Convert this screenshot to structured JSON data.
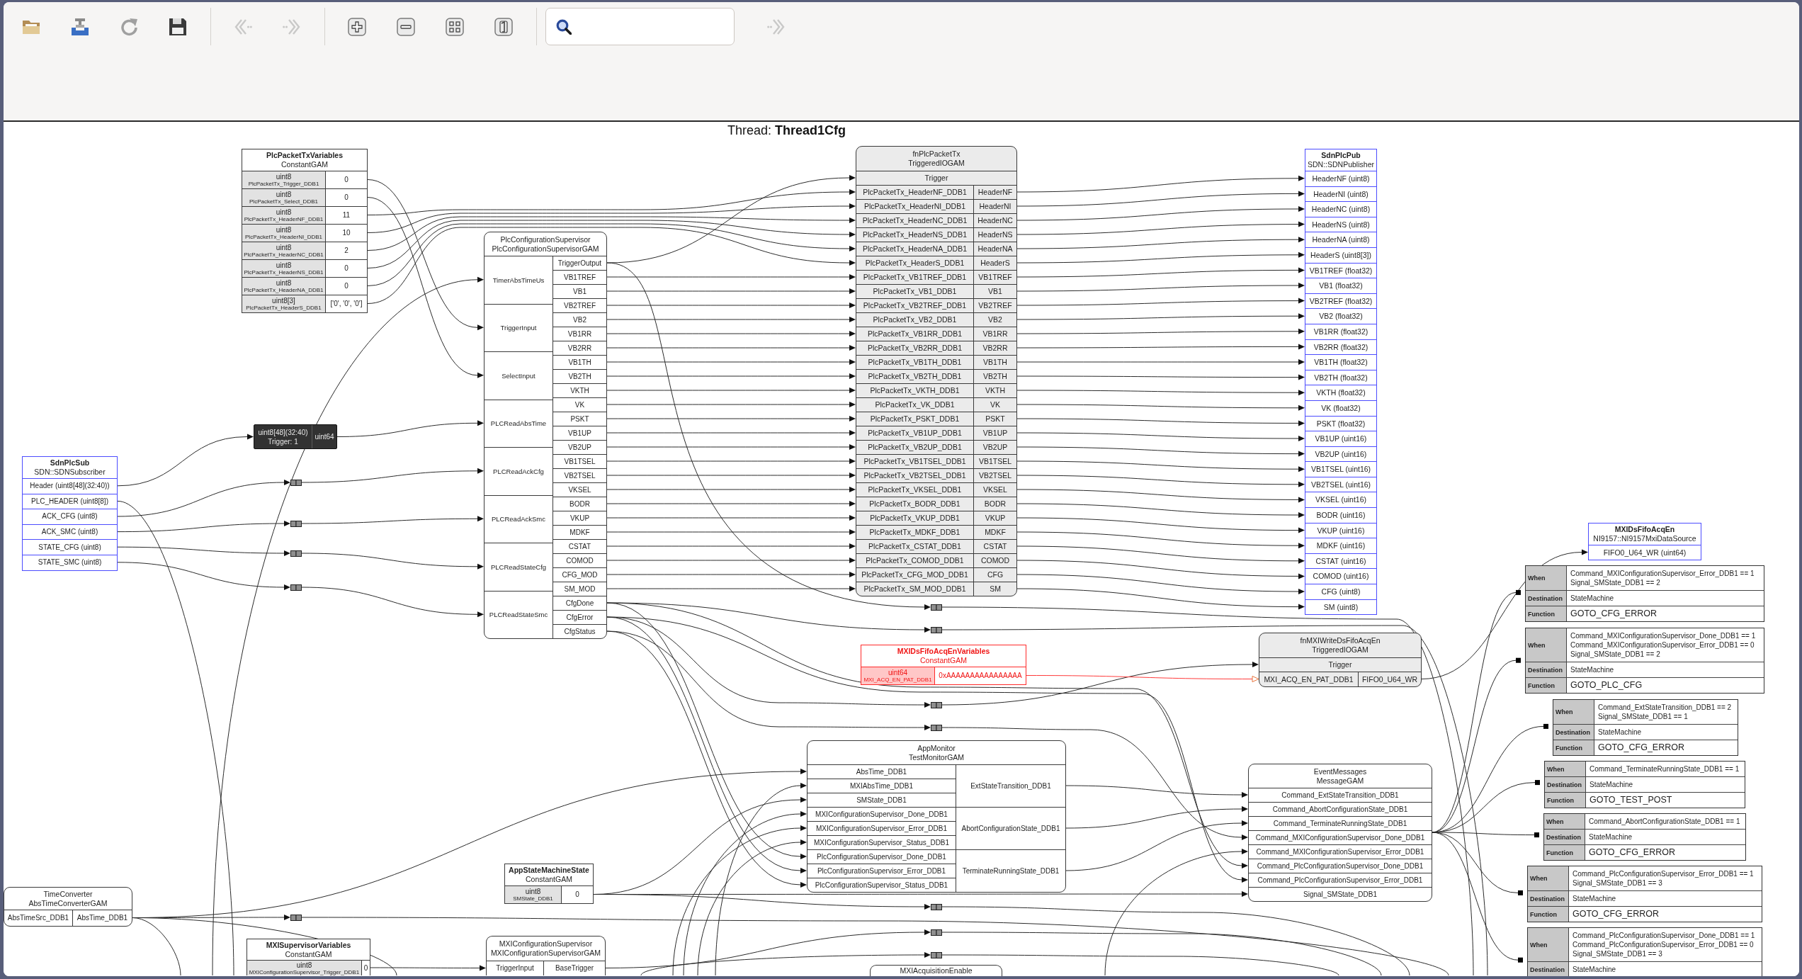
{
  "toolbar": {
    "groups": [
      [
        {
          "kind": "open",
          "disabled": false
        },
        {
          "kind": "import",
          "disabled": false
        },
        {
          "kind": "reload",
          "disabled": false
        },
        {
          "kind": "save",
          "disabled": false
        }
      ],
      [
        {
          "kind": "back",
          "disabled": true
        },
        {
          "kind": "forward",
          "disabled": true
        }
      ],
      [
        {
          "kind": "zoom_in",
          "disabled": false
        },
        {
          "kind": "zoom_out",
          "disabled": false
        },
        {
          "kind": "zoom_fit",
          "disabled": false
        },
        {
          "kind": "zoom_reset",
          "disabled": false
        }
      ]
    ],
    "find_next": {
      "disabled": true
    }
  },
  "thread_title": "Thread: **Thread1Cfg**",
  "nodes": [
    {
      "kind": "constant",
      "name": "PlcPacketTxVariables",
      "class": "ConstantGAM",
      "highlighted": false,
      "rows": [
        {
          "type": "uint8",
          "signal": "PlcPacketTx_Trigger_DDB1",
          "value": "0"
        },
        {
          "type": "uint8",
          "signal": "PlcPacketTx_Select_DDB1",
          "value": "0"
        },
        {
          "type": "uint8",
          "signal": "PlcPacketTx_HeaderNF_DDB1",
          "value": "11"
        },
        {
          "type": "uint8",
          "signal": "PlcPacketTx_HeaderNI_DDB1",
          "value": "10"
        },
        {
          "type": "uint8",
          "signal": "PlcPacketTx_HeaderNC_DDB1",
          "value": "2"
        },
        {
          "type": "uint8",
          "signal": "PlcPacketTx_HeaderNS_DDB1",
          "value": "0"
        },
        {
          "type": "uint8",
          "signal": "PlcPacketTx_HeaderNA_DDB1",
          "value": "0"
        },
        {
          "type": "uint8[3]",
          "signal": "PlcPacketTx_HeaderS_DDB1",
          "value": "['0', '0', '0']"
        }
      ]
    },
    {
      "kind": "buffer",
      "type": "uint8[48](32:40)",
      "trigger": "Trigger: 1",
      "output": "uint64"
    },
    {
      "kind": "datasource",
      "name": "SdnPlcSub",
      "class": "SDN::SDNSubscriber",
      "signals": [
        "Header (uint8[48](32:40))",
        "PLC_HEADER (uint8[8])",
        "ACK_CFG (uint8)",
        "ACK_SMC (uint8)",
        "STATE_CFG (uint8)",
        "STATE_SMC (uint8)"
      ]
    },
    {
      "kind": "gam",
      "name": "PlcConfigurationSupervisor",
      "class": "PlcConfigurationSupervisorGAM",
      "inputs": [
        "TimerAbsTimeUs",
        "TriggerInput",
        "SelectInput",
        "PLCReadAbsTime",
        "PLCReadAckCfg",
        "PLCReadAckSmc",
        "PLCReadStateCfg",
        "PLCReadStateSmc"
      ],
      "outputs": [
        "TriggerOutput",
        "VB1TREF",
        "VB1",
        "VB2TREF",
        "VB2",
        "VB1RR",
        "VB2RR",
        "VB1TH",
        "VB2TH",
        "VKTH",
        "VK",
        "PSKT",
        "VB1UP",
        "VB2UP",
        "VB1TSEL",
        "VB2TSEL",
        "VKSEL",
        "BODR",
        "VKUP",
        "MDKF",
        "CSTAT",
        "COMOD",
        "CFG_MOD",
        "SM_MOD",
        "CfgDone",
        "CfgError",
        "CfgStatus"
      ]
    },
    {
      "kind": "iogam",
      "name": "fnPlcPacketTx",
      "class": "TriggeredIOGAM",
      "trigger": "Trigger",
      "pairs": [
        {
          "input": "PlcPacketTx_HeaderNF_DDB1",
          "output": "HeaderNF"
        },
        {
          "input": "PlcPacketTx_HeaderNI_DDB1",
          "output": "HeaderNI"
        },
        {
          "input": "PlcPacketTx_HeaderNC_DDB1",
          "output": "HeaderNC"
        },
        {
          "input": "PlcPacketTx_HeaderNS_DDB1",
          "output": "HeaderNS"
        },
        {
          "input": "PlcPacketTx_HeaderNA_DDB1",
          "output": "HeaderNA"
        },
        {
          "input": "PlcPacketTx_HeaderS_DDB1",
          "output": "HeaderS"
        },
        {
          "input": "PlcPacketTx_VB1TREF_DDB1",
          "output": "VB1TREF"
        },
        {
          "input": "PlcPacketTx_VB1_DDB1",
          "output": "VB1"
        },
        {
          "input": "PlcPacketTx_VB2TREF_DDB1",
          "output": "VB2TREF"
        },
        {
          "input": "PlcPacketTx_VB2_DDB1",
          "output": "VB2"
        },
        {
          "input": "PlcPacketTx_VB1RR_DDB1",
          "output": "VB1RR"
        },
        {
          "input": "PlcPacketTx_VB2RR_DDB1",
          "output": "VB2RR"
        },
        {
          "input": "PlcPacketTx_VB1TH_DDB1",
          "output": "VB1TH"
        },
        {
          "input": "PlcPacketTx_VB2TH_DDB1",
          "output": "VB2TH"
        },
        {
          "input": "PlcPacketTx_VKTH_DDB1",
          "output": "VKTH"
        },
        {
          "input": "PlcPacketTx_VK_DDB1",
          "output": "VK"
        },
        {
          "input": "PlcPacketTx_PSKT_DDB1",
          "output": "PSKT"
        },
        {
          "input": "PlcPacketTx_VB1UP_DDB1",
          "output": "VB1UP"
        },
        {
          "input": "PlcPacketTx_VB2UP_DDB1",
          "output": "VB2UP"
        },
        {
          "input": "PlcPacketTx_VB1TSEL_DDB1",
          "output": "VB1TSEL"
        },
        {
          "input": "PlcPacketTx_VB2TSEL_DDB1",
          "output": "VB2TSEL"
        },
        {
          "input": "PlcPacketTx_VKSEL_DDB1",
          "output": "VKSEL"
        },
        {
          "input": "PlcPacketTx_BODR_DDB1",
          "output": "BODR"
        },
        {
          "input": "PlcPacketTx_VKUP_DDB1",
          "output": "VKUP"
        },
        {
          "input": "PlcPacketTx_MDKF_DDB1",
          "output": "MDKF"
        },
        {
          "input": "PlcPacketTx_CSTAT_DDB1",
          "output": "CSTAT"
        },
        {
          "input": "PlcPacketTx_COMOD_DDB1",
          "output": "COMOD"
        },
        {
          "input": "PlcPacketTx_CFG_MOD_DDB1",
          "output": "CFG"
        },
        {
          "input": "PlcPacketTx_SM_MOD_DDB1",
          "output": "SM"
        }
      ]
    },
    {
      "kind": "datasource",
      "name": "SdnPlcPub",
      "class": "SDN::SDNPublisher",
      "signals": [
        "HeaderNF (uint8)",
        "HeaderNI (uint8)",
        "HeaderNC (uint8)",
        "HeaderNS (uint8)",
        "HeaderNA (uint8)",
        "HeaderS (uint8[3])",
        "VB1TREF (float32)",
        "VB1 (float32)",
        "VB2TREF (float32)",
        "VB2 (float32)",
        "VB1RR (float32)",
        "VB2RR (float32)",
        "VB1TH (float32)",
        "VB2TH (float32)",
        "VKTH (float32)",
        "VK (float32)",
        "PSKT (float32)",
        "VB1UP (uint16)",
        "VB2UP (uint16)",
        "VB1TSEL (uint16)",
        "VB2TSEL (uint16)",
        "VKSEL (uint16)",
        "BODR (uint16)",
        "VKUP (uint16)",
        "MDKF (uint16)",
        "CSTAT (uint16)",
        "COMOD (uint16)",
        "CFG (uint8)",
        "SM (uint8)"
      ]
    },
    {
      "kind": "datasource",
      "name": "MXIDsFifoAcqEn",
      "class": "NI9157::NI9157MxiDataSource",
      "signals": [
        "FIFO0_U64_WR (uint64)"
      ]
    },
    {
      "kind": "constant",
      "name": "MXIDsFifoAcqEnVariables",
      "class": "ConstantGAM",
      "highlighted": true,
      "rows": [
        {
          "type": "uint64",
          "signal": "MXI_ACQ_EN_PAT_DDB1",
          "value": "0xAAAAAAAAAAAAAAAA"
        }
      ]
    },
    {
      "kind": "iogam",
      "name": "fnMXIWriteDsFifoAcqEn",
      "class": "TriggeredIOGAM",
      "trigger": "Trigger",
      "pairs": [
        {
          "input": "MXI_ACQ_EN_PAT_DDB1",
          "output": "FIFO0_U64_WR"
        }
      ]
    },
    {
      "kind": "gam",
      "name": "TimeConverter",
      "class": "AbsTimeConverterGAM",
      "inputs": [
        "AbsTimeSrc_DDB1"
      ],
      "outputs": [
        "AbsTime_DDB1"
      ]
    },
    {
      "kind": "constant",
      "name": "AppStateMachineState",
      "class": "ConstantGAM",
      "highlighted": false,
      "rows": [
        {
          "type": "uint8",
          "signal": "SMState_DDB1",
          "value": "0"
        }
      ]
    },
    {
      "kind": "gam",
      "name": "AppMonitor",
      "class": "TestMonitorGAM",
      "inputs": [
        "AbsTime_DDB1",
        "MXIAbsTime_DDB1",
        "SMState_DDB1",
        "MXIConfigurationSupervisor_Done_DDB1",
        "MXIConfigurationSupervisor_Error_DDB1",
        "MXIConfigurationSupervisor_Status_DDB1",
        "PlcConfigurationSupervisor_Done_DDB1",
        "PlcConfigurationSupervisor_Error_DDB1",
        "PlcConfigurationSupervisor_Status_DDB1"
      ],
      "outputs": [
        "ExtStateTransition_DDB1",
        "AbortConfigurationState_DDB1",
        "TerminateRunningState_DDB1"
      ]
    },
    {
      "kind": "gam",
      "name": "EventMessages",
      "class": "MessageGAM",
      "inputs": [
        "Command_ExtStateTransition_DDB1",
        "Command_AbortConfigurationState_DDB1",
        "Command_TerminateRunningState_DDB1",
        "Command_MXIConfigurationSupervisor_Done_DDB1",
        "Command_MXIConfigurationSupervisor_Error_DDB1",
        "Command_PlcConfigurationSupervisor_Done_DDB1",
        "Command_PlcConfigurationSupervisor_Error_DDB1",
        "Signal_SMState_DDB1"
      ]
    },
    {
      "kind": "constant",
      "name": "MXISupervisorVariables",
      "class": "ConstantGAM",
      "highlighted": false,
      "rows": [
        {
          "type": "uint8",
          "signal": "MXIConfigurationSupervisor_Trigger_DDB1",
          "value": "0"
        }
      ]
    },
    {
      "kind": "gam",
      "name": "MXIConfigurationSupervisor",
      "class": "MXIConfigurationSupervisorGAM",
      "inputs": [
        "TriggerInput"
      ],
      "outputs": [
        "BaseTrigger"
      ]
    },
    {
      "kind": "gam",
      "name": "MXIAcquisitionEnable"
    }
  ],
  "messages": [
    {
      "rows": [
        {
          "kind": "when",
          "label": "When",
          "lines": [
            "Command_MXIConfigurationSupervisor_Error_DDB1 == 1",
            "Signal_SMState_DDB1 == 2"
          ]
        },
        {
          "kind": "destination",
          "label": "Destination",
          "lines": [
            "StateMachine"
          ]
        },
        {
          "kind": "function",
          "label": "Function",
          "lines": [
            "GOTO_CFG_ERROR"
          ]
        }
      ]
    },
    {
      "rows": [
        {
          "kind": "when",
          "label": "When",
          "lines": [
            "Command_MXIConfigurationSupervisor_Done_DDB1 == 1",
            "Command_MXIConfigurationSupervisor_Error_DDB1 == 0",
            "Signal_SMState_DDB1 == 2"
          ]
        },
        {
          "kind": "destination",
          "label": "Destination",
          "lines": [
            "StateMachine"
          ]
        },
        {
          "kind": "function",
          "label": "Function",
          "lines": [
            "GOTO_PLC_CFG"
          ]
        }
      ]
    },
    {
      "rows": [
        {
          "kind": "when",
          "label": "When",
          "lines": [
            "Command_ExtStateTransition_DDB1 == 2",
            "Signal_SMState_DDB1 == 1"
          ]
        },
        {
          "kind": "destination",
          "label": "Destination",
          "lines": [
            "StateMachine"
          ]
        },
        {
          "kind": "function",
          "label": "Function",
          "lines": [
            "GOTO_CFG_ERROR"
          ]
        }
      ]
    },
    {
      "rows": [
        {
          "kind": "when",
          "label": "When",
          "lines": [
            "Command_TerminateRunningState_DDB1 == 1"
          ]
        },
        {
          "kind": "destination",
          "label": "Destination",
          "lines": [
            "StateMachine"
          ]
        },
        {
          "kind": "function",
          "label": "Function",
          "lines": [
            "GOTO_TEST_POST"
          ]
        }
      ]
    },
    {
      "rows": [
        {
          "kind": "when",
          "label": "When",
          "lines": [
            "Command_AbortConfigurationState_DDB1 == 1"
          ]
        },
        {
          "kind": "destination",
          "label": "Destination",
          "lines": [
            "StateMachine"
          ]
        },
        {
          "kind": "function",
          "label": "Function",
          "lines": [
            "GOTO_CFG_ERROR"
          ]
        }
      ]
    },
    {
      "rows": [
        {
          "kind": "when",
          "label": "When",
          "lines": [
            "Command_PlcConfigurationSupervisor_Error_DDB1 == 1",
            "Signal_SMState_DDB1 == 3"
          ]
        },
        {
          "kind": "destination",
          "label": "Destination",
          "lines": [
            "StateMachine"
          ]
        },
        {
          "kind": "function",
          "label": "Function",
          "lines": [
            "GOTO_CFG_ERROR"
          ]
        }
      ]
    },
    {
      "rows": [
        {
          "kind": "when",
          "label": "When",
          "lines": [
            "Command_PlcConfigurationSupervisor_Done_DDB1 == 1",
            "Command_PlcConfigurationSupervisor_Error_DDB1 == 0",
            "Signal_SMState_DDB1 == 3"
          ]
        },
        {
          "kind": "destination",
          "label": "Destination",
          "lines": [
            "StateMachine"
          ]
        }
      ]
    }
  ]
}
